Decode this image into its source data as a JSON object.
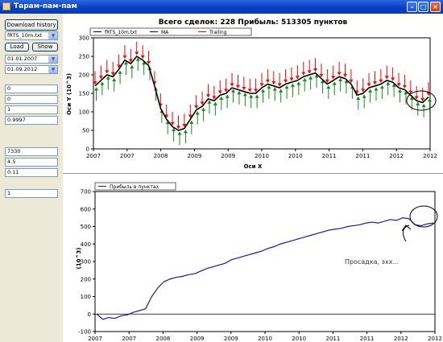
{
  "window": {
    "title": "Тарам-пам-пам"
  },
  "sidebar": {
    "download_label": "Download history",
    "instrument": "fRTS_10m.txt",
    "load_label": "Load",
    "show_label": "Show",
    "date_from": "01.01.2007",
    "date_to": "01.09.2012",
    "params_a": [
      "0",
      "0",
      "1",
      "0.9997"
    ],
    "params_b": [
      "7330",
      "4.5",
      "0.11"
    ],
    "param_c": "1"
  },
  "chart_data": [
    {
      "type": "line",
      "title": "Всего сделок:  228 Прибыль: 513305 пунктов",
      "xlabel": "Оси X",
      "ylabel": "Оси Y (10^3)",
      "ylim": [
        0,
        300
      ],
      "yticks": [
        0,
        50,
        100,
        150,
        200,
        250,
        300
      ],
      "xticks": [
        "2007",
        "2007",
        "2008",
        "2009",
        "2009",
        "2010",
        "2010",
        "2011",
        "2011",
        "2012",
        "2012"
      ],
      "grid": false,
      "legend_position": "top-left",
      "series": [
        {
          "name": "fRTS_10m.txt",
          "color": "#000000",
          "values": [
            170,
            185,
            200,
            195,
            215,
            240,
            230,
            250,
            240,
            225,
            170,
            110,
            80,
            60,
            50,
            55,
            80,
            105,
            115,
            135,
            130,
            145,
            150,
            165,
            160,
            155,
            150,
            150,
            165,
            175,
            170,
            165,
            175,
            180,
            185,
            195,
            200,
            205,
            190,
            175,
            185,
            195,
            190,
            175,
            145,
            150,
            165,
            170,
            175,
            185,
            180,
            165,
            160,
            145,
            130,
            125,
            140
          ]
        },
        {
          "name": "MA",
          "color": "#000080",
          "values": []
        },
        {
          "name": "Trailing",
          "color": "#ff0000",
          "values": []
        }
      ],
      "annotations": [
        {
          "shape": "ellipse",
          "meaning": "highlighted recent drawdown area"
        }
      ]
    },
    {
      "type": "line",
      "title": "",
      "xlabel": "",
      "ylabel": "(10^3)",
      "ylim": [
        -100,
        700
      ],
      "yticks": [
        -100,
        0,
        100,
        200,
        300,
        400,
        500,
        600,
        700
      ],
      "xticks": [
        "2007",
        "2007",
        "2008",
        "2009",
        "2009",
        "2010",
        "2010",
        "2011",
        "2011",
        "2012",
        "2012"
      ],
      "grid": false,
      "legend_position": "top-left",
      "series": [
        {
          "name": "Прибыль в пунктах",
          "color": "#1a1aa8",
          "values": [
            0,
            -30,
            -20,
            -25,
            -10,
            -5,
            10,
            20,
            30,
            100,
            150,
            185,
            200,
            210,
            215,
            225,
            230,
            245,
            260,
            270,
            280,
            290,
            310,
            320,
            330,
            340,
            350,
            360,
            375,
            385,
            400,
            410,
            420,
            430,
            440,
            450,
            460,
            470,
            480,
            485,
            490,
            500,
            505,
            510,
            520,
            525,
            520,
            530,
            540,
            535,
            550,
            545,
            510,
            505,
            515,
            520
          ]
        }
      ],
      "annotations": [
        {
          "text": "Просадка, эхх...",
          "shape": "ellipse and arrow"
        }
      ]
    }
  ]
}
